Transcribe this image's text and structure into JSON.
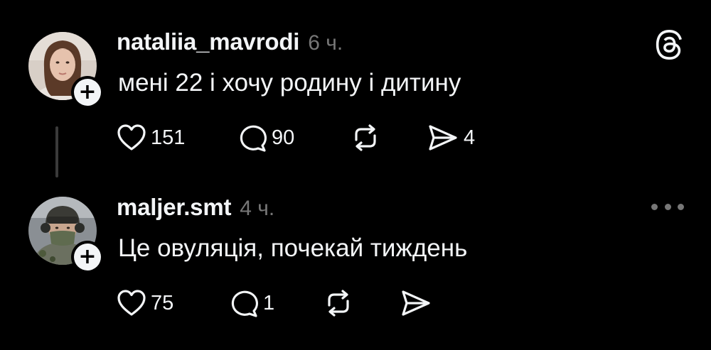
{
  "posts": [
    {
      "username": "nataliia_mavrodi",
      "time": "6 ч.",
      "text": "мені 22 і хочу родину і дитину",
      "likes": "151",
      "replies": "90",
      "reposts": "",
      "shares": "4",
      "avatar_icon": "woman-portrait",
      "follow_label": "+"
    },
    {
      "username": "maljer.smt",
      "time": "4 ч.",
      "text": "Це овуляція, почекай тиждень",
      "likes": "75",
      "replies": "1",
      "reposts": "",
      "shares": "",
      "avatar_icon": "soldier-portrait",
      "follow_label": "+"
    }
  ],
  "icons": {
    "logo": "threads-logo-icon",
    "more": "more-options-icon",
    "like": "heart-icon",
    "reply": "comment-icon",
    "repost": "repost-icon",
    "share": "send-icon"
  },
  "colors": {
    "background": "#000000",
    "text": "#f3f5f7",
    "muted": "#777777",
    "thread_line": "#3a3a3a"
  }
}
